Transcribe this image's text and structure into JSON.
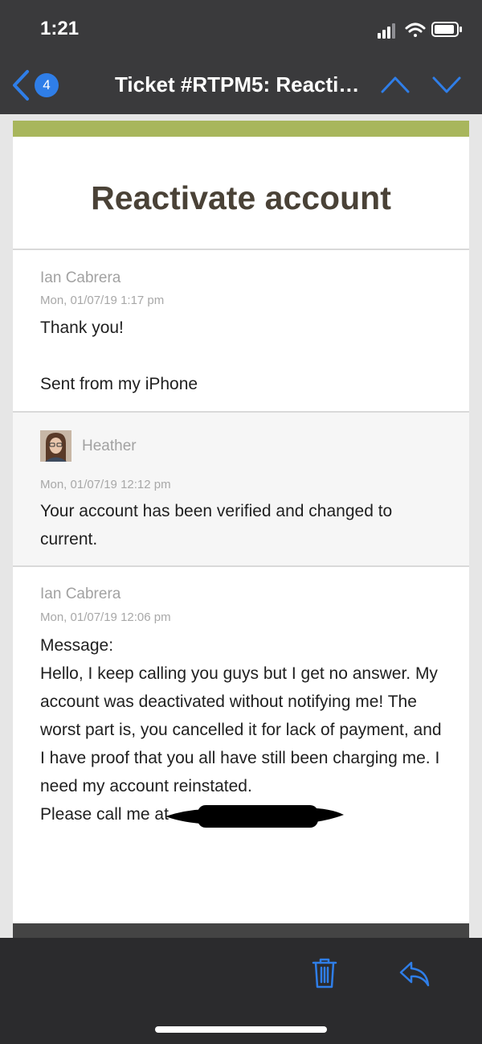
{
  "status_bar": {
    "time": "1:21"
  },
  "nav": {
    "badge_count": "4",
    "title": "Ticket #RTPM5: Reactivate account"
  },
  "email": {
    "subject": "Reactivate account",
    "accent_color": "#a8b65c",
    "messages": [
      {
        "author": "Ian Cabrera",
        "date": "Mon, 01/07/19 1:17 pm",
        "body": "Thank you!",
        "signature": "Sent from my iPhone"
      },
      {
        "author": "Heather",
        "date": "Mon, 01/07/19 12:12 pm",
        "body": "Your account has been verified and changed to current."
      },
      {
        "author": "Ian Cabrera",
        "date": "Mon, 01/07/19 12:06 pm",
        "body_label": "Message:",
        "body": "Hello, I keep calling you guys but I get no answer. My account was deactivated without notifying me! The worst part is, you cancelled it for lack of payment, and I have proof that you all have still been charging me. I need my account reinstated.",
        "body_end": "Please call me at"
      }
    ]
  },
  "toolbar": {
    "icons": [
      "trash-icon",
      "reply-icon"
    ],
    "accent_color": "#2f7ee8"
  }
}
